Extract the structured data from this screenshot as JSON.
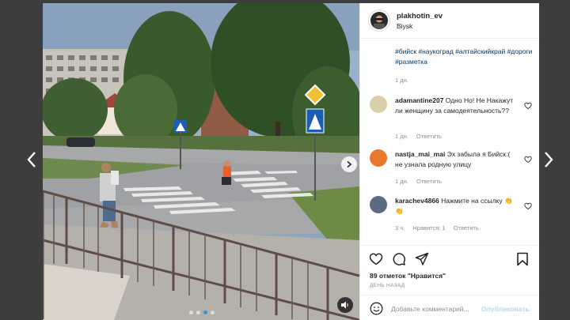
{
  "post": {
    "username": "plakhotin_ev",
    "location": "Biysk",
    "caption": "#бийск #наукоград #алтайскийкрай #дороги #разметка",
    "caption_time": "1 дн."
  },
  "comments": [
    {
      "user": "adamantine207",
      "text": "Одно Но! Не Накажут ли женщину за самодеятельность??",
      "time": "1 дн.",
      "reply": "Ответить",
      "avatar_color": "#d9cfa8"
    },
    {
      "user": "nastja_mai_mai",
      "text": "Эх забыла я Бийск:( не узнала родную улицу",
      "time": "1 дн.",
      "reply": "Ответить",
      "avatar_color": "#e8782e"
    },
    {
      "user": "karachev4866",
      "text": "Нажмите на ссылку 👏👏",
      "time": "3 ч.",
      "likes": "Нравится: 1",
      "reply": "Ответить",
      "avatar_color": "#5b6b82"
    }
  ],
  "actions": {
    "likes_count": "89",
    "likes_label": "отметок \"Нравится\"",
    "date_label": "ДЕНЬ НАЗАД",
    "comment_placeholder": "Добавьте комментарий...",
    "publish_label": "Опубликовать"
  },
  "icons": {
    "nav_left": "chevron-left-icon",
    "nav_right": "chevron-right-icon",
    "media_next": "chevron-right-icon",
    "sound": "speaker-muted-icon",
    "like": "heart-icon",
    "comment": "comment-bubble-icon",
    "share": "paper-plane-icon",
    "save": "bookmark-icon",
    "emoji": "smiley-icon"
  },
  "carousel": {
    "slides": 4,
    "active_index": 2
  },
  "colors": {
    "link": "#00376b",
    "accent_blue": "#1c9cf0",
    "publish_disabled": "#b3dbff",
    "muted": "#8e8e8e"
  }
}
